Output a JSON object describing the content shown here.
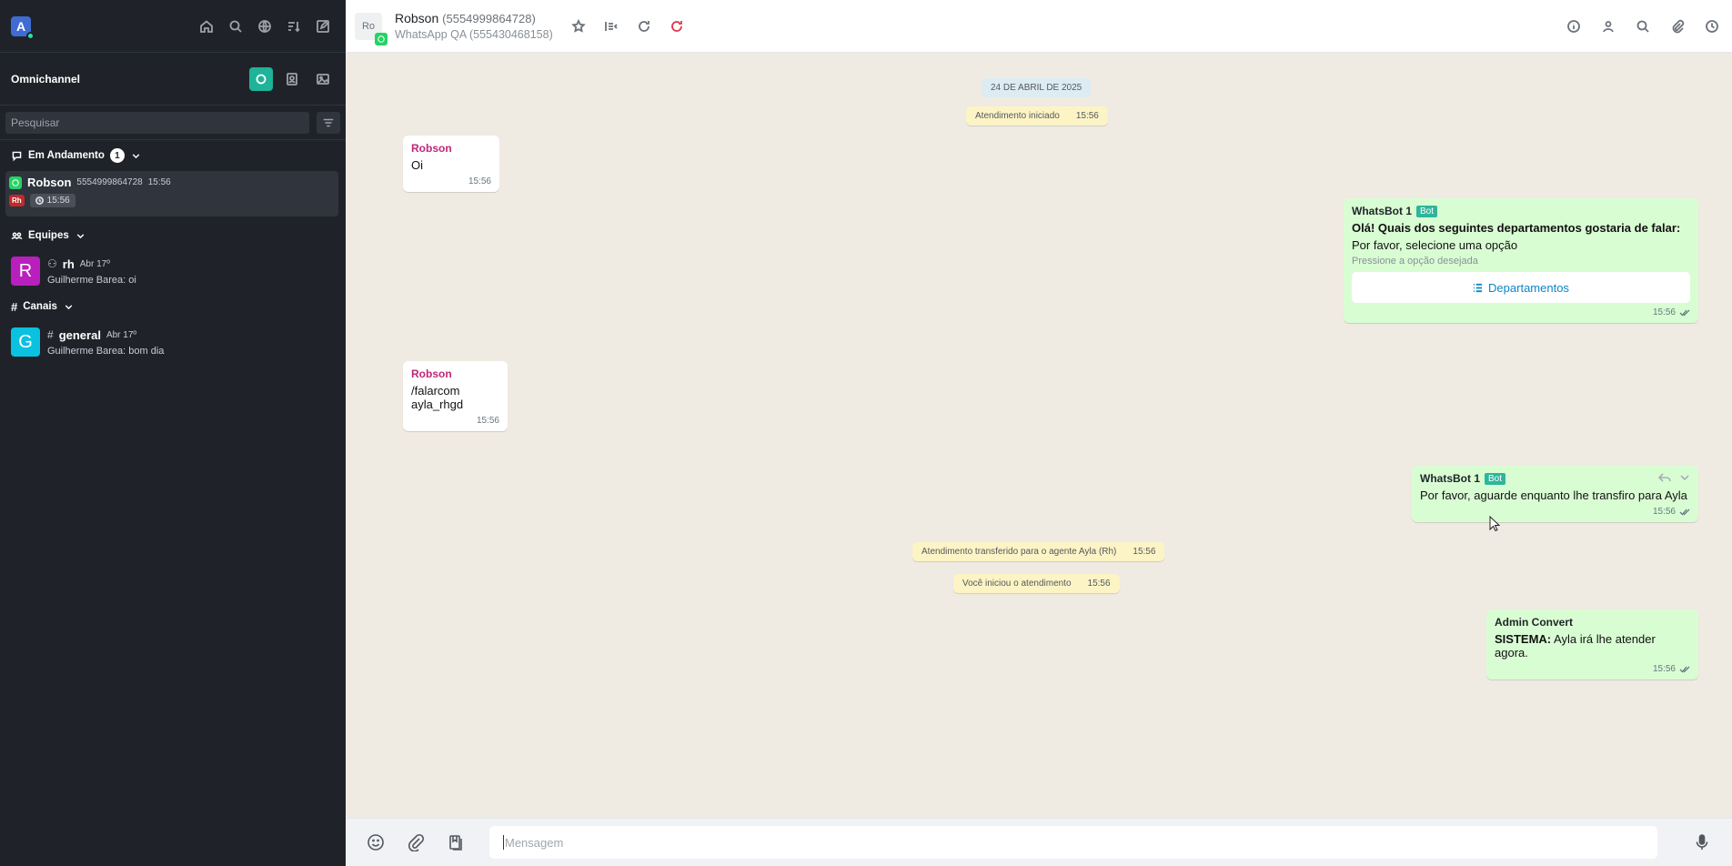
{
  "sidebar": {
    "workspace_initial": "A",
    "omnichannel_title": "Omnichannel",
    "search_placeholder": "Pesquisar",
    "sections": {
      "em_andamento": "Em Andamento",
      "em_andamento_count": "1",
      "equipes": "Equipes",
      "canais": "Canais"
    },
    "active_chat": {
      "name": "Robson",
      "phone": "5554999864728",
      "time": "15:56",
      "tag": "Rh",
      "wait_time": "15:56"
    },
    "teams": [
      {
        "initial": "R",
        "name": "rh",
        "date": "Abr 17º",
        "last_message": "Guilherme Barea: oi"
      }
    ],
    "channels": [
      {
        "initial": "G",
        "name": "general",
        "date": "Abr 17º",
        "last_message": "Guilherme Barea: bom dia"
      }
    ]
  },
  "header": {
    "avatar_text": "Ro",
    "contact_name": "Robson",
    "contact_phone": "(5554999864728)",
    "channel": "WhatsApp QA (555430468158)"
  },
  "chat": {
    "date_divider": "24 DE ABRIL DE 2025",
    "system_messages": [
      {
        "text": "Atendimento iniciado",
        "time": "15:56"
      },
      {
        "text": "Atendimento transferido para o agente Ayla (Rh)",
        "time": "15:56"
      },
      {
        "text": "Você iniciou o atendimento",
        "time": "15:56"
      }
    ],
    "messages": [
      {
        "author": "Robson",
        "text": "Oi",
        "time": "15:56"
      },
      {
        "author": "WhatsBot 1",
        "tag": "Bot",
        "heading": "Olá! Quais dos seguintes departamentos gostaria de falar:",
        "text": "Por favor, selecione uma opção",
        "hint": "Pressione a opção desejada",
        "button": "Departamentos",
        "time": "15:56"
      },
      {
        "author": "Robson",
        "text": "/falarcom ayla_rhgd",
        "time": "15:56"
      },
      {
        "author": "WhatsBot 1",
        "tag": "Bot",
        "text": "Por favor, aguarde enquanto lhe transfiro para Ayla",
        "time": "15:56"
      },
      {
        "author": "Admin Convert",
        "bold_prefix": "SISTEMA:",
        "text": "Ayla irá lhe atender agora.",
        "time": "15:56"
      }
    ]
  },
  "composer": {
    "placeholder": "Mensagem"
  },
  "colors": {
    "sidebar_bg": "#1f2329",
    "accent": "#1fb399",
    "chat_bg": "#efeae2",
    "outgoing_bubble": "#d9fdd3",
    "system_bubble": "#fdf4c5"
  }
}
